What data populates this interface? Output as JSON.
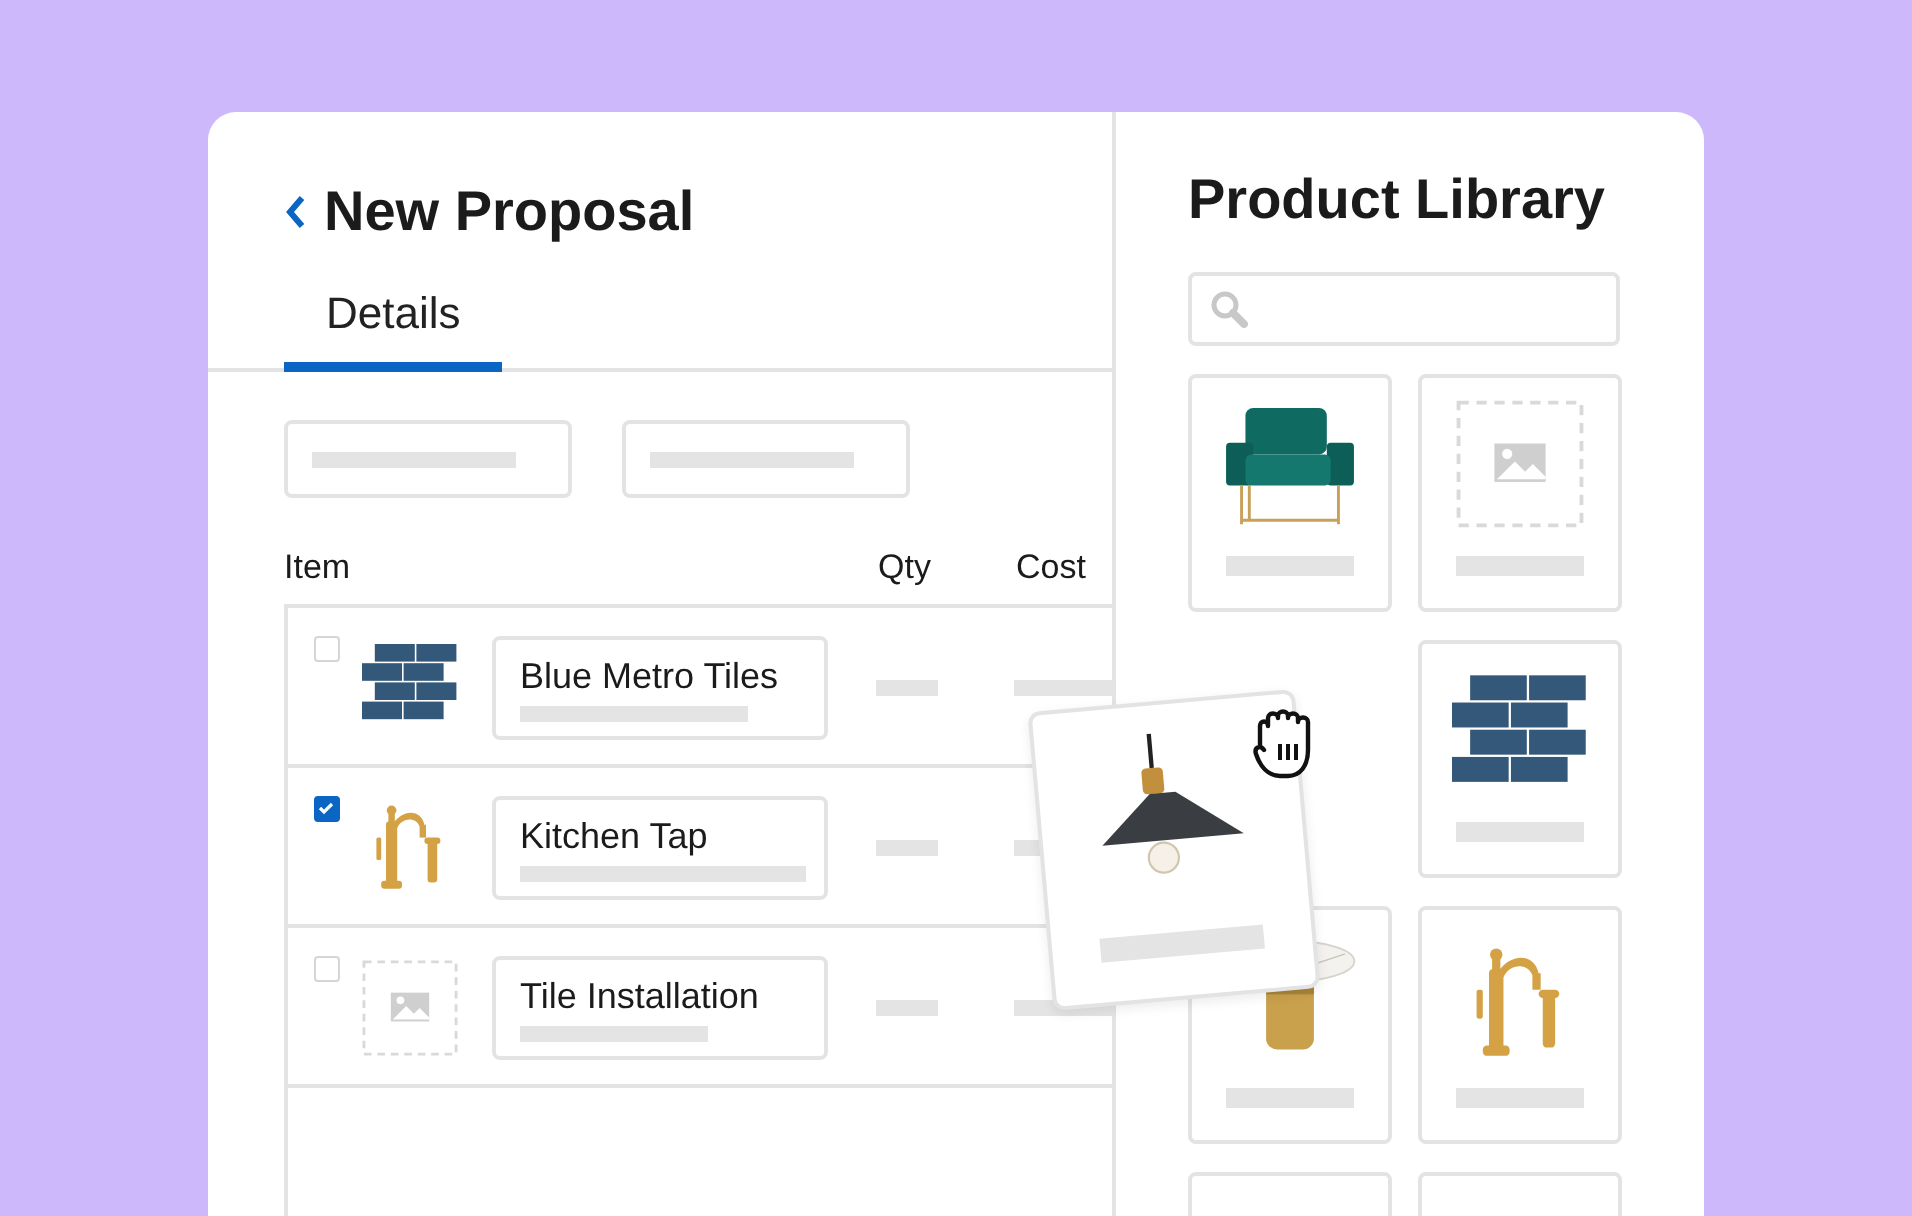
{
  "proposal": {
    "title": "New Proposal",
    "tabs": [
      {
        "label": "Details",
        "selected": true
      }
    ],
    "columns": [
      "Item",
      "Qty",
      "Cost"
    ],
    "rows": [
      {
        "name": "Blue Metro Tiles",
        "checked": false,
        "kind": "tiles"
      },
      {
        "name": "Kitchen Tap",
        "checked": true,
        "kind": "faucet"
      },
      {
        "name": "Tile Installation",
        "checked": false,
        "kind": "image-placeholder"
      }
    ]
  },
  "library": {
    "title": "Product Library",
    "tiles": [
      {
        "kind": "armchair"
      },
      {
        "kind": "image-placeholder"
      },
      {
        "kind": "empty"
      },
      {
        "kind": "tiles"
      },
      {
        "kind": "side-table"
      },
      {
        "kind": "faucet"
      },
      {
        "kind": "blank"
      },
      {
        "kind": "blank"
      }
    ]
  },
  "dragged_card": {
    "kind": "lamp"
  }
}
